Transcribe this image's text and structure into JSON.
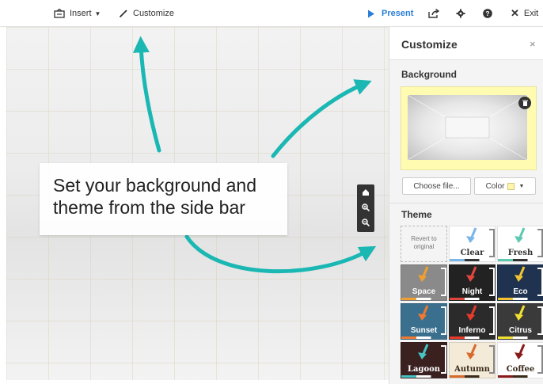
{
  "toolbar": {
    "insert_label": "Insert",
    "customize_label": "Customize",
    "present_label": "Present",
    "exit_label": "Exit"
  },
  "canvas": {
    "caption_line1": "Set your background and",
    "caption_line2": "theme from the side bar"
  },
  "sidebar": {
    "title": "Customize",
    "close_glyph": "×",
    "background_heading": "Background",
    "choose_file_label": "Choose file...",
    "color_label": "Color",
    "theme_heading": "Theme",
    "revert_label_line1": "Revert to",
    "revert_label_line2": "original",
    "themes": [
      {
        "name": "Clear",
        "bg": "#ffffff",
        "text": "#333333",
        "accent": "#7bb6e8"
      },
      {
        "name": "Fresh",
        "bg": "#ffffff",
        "text": "#333333",
        "accent": "#5cc9b0"
      },
      {
        "name": "Space",
        "bg": "#8a8a8a",
        "text": "#ffffff",
        "accent": "#f0a030"
      },
      {
        "name": "Night",
        "bg": "#222222",
        "text": "#ffffff",
        "accent": "#e0463c"
      },
      {
        "name": "Eco",
        "bg": "#1f3350",
        "text": "#ffffff",
        "accent": "#f2c230"
      },
      {
        "name": "Sunset",
        "bg": "#3a6f8e",
        "text": "#ffffff",
        "accent": "#f07830"
      },
      {
        "name": "Inferno",
        "bg": "#2b2b2b",
        "text": "#ffffff",
        "accent": "#e83a2a"
      },
      {
        "name": "Citrus",
        "bg": "#3a3a3a",
        "text": "#ffffff",
        "accent": "#f0e030"
      },
      {
        "name": "Lagoon",
        "bg": "#3b2020",
        "text": "#ffffff",
        "accent": "#46c4c4"
      },
      {
        "name": "Autumn",
        "bg": "#f3ead8",
        "text": "#3a2a1a",
        "accent": "#d76a2a"
      },
      {
        "name": "Coffee",
        "bg": "#ffffff",
        "text": "#3a2a1a",
        "accent": "#8a1a1a"
      }
    ]
  },
  "colors": {
    "accent_present": "#2b7fd6",
    "arrow_teal": "#1ab7b3",
    "background_swatch": "#fffbb0"
  }
}
